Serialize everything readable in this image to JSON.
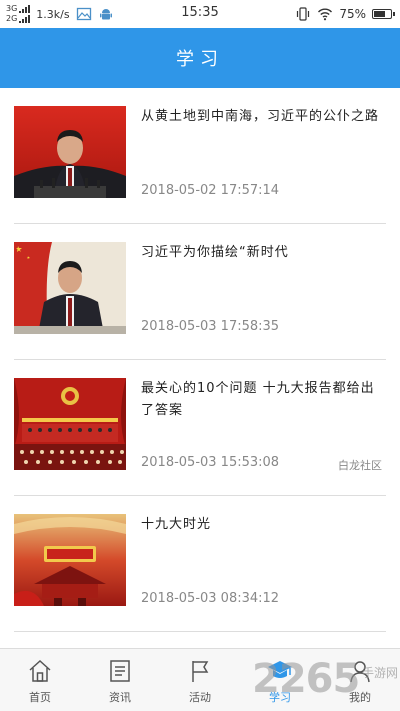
{
  "status_bar": {
    "network_1": "3G",
    "network_2": "2G",
    "speed": "1.3k/s",
    "time": "15:35",
    "battery": "75%",
    "battery_level": 0.75
  },
  "header": {
    "title": "学习"
  },
  "articles": [
    {
      "title": "从黄土地到中南海，习近平的公仆之路",
      "date": "2018-05-02 17:57:14",
      "source": ""
    },
    {
      "title": "习近平为你描绘“新时代",
      "date": "2018-05-03 17:58:35",
      "source": ""
    },
    {
      "title": "最关心的10个问题 十九大报告都给出了答案",
      "date": "2018-05-03 15:53:08",
      "source": "白龙社区"
    },
    {
      "title": "十九大时光",
      "date": "2018-05-03 08:34:12",
      "source": ""
    }
  ],
  "tabs": [
    {
      "label": "首页",
      "icon": "home-icon"
    },
    {
      "label": "资讯",
      "icon": "news-icon"
    },
    {
      "label": "活动",
      "icon": "flag-icon"
    },
    {
      "label": "学习",
      "icon": "graduation-cap-icon",
      "active": true
    },
    {
      "label": "我的",
      "icon": "person-icon"
    }
  ],
  "watermark": {
    "text": "2265",
    "sub": "手游网"
  },
  "colors": {
    "accent": "#2f96e8",
    "date_text": "#888888"
  }
}
